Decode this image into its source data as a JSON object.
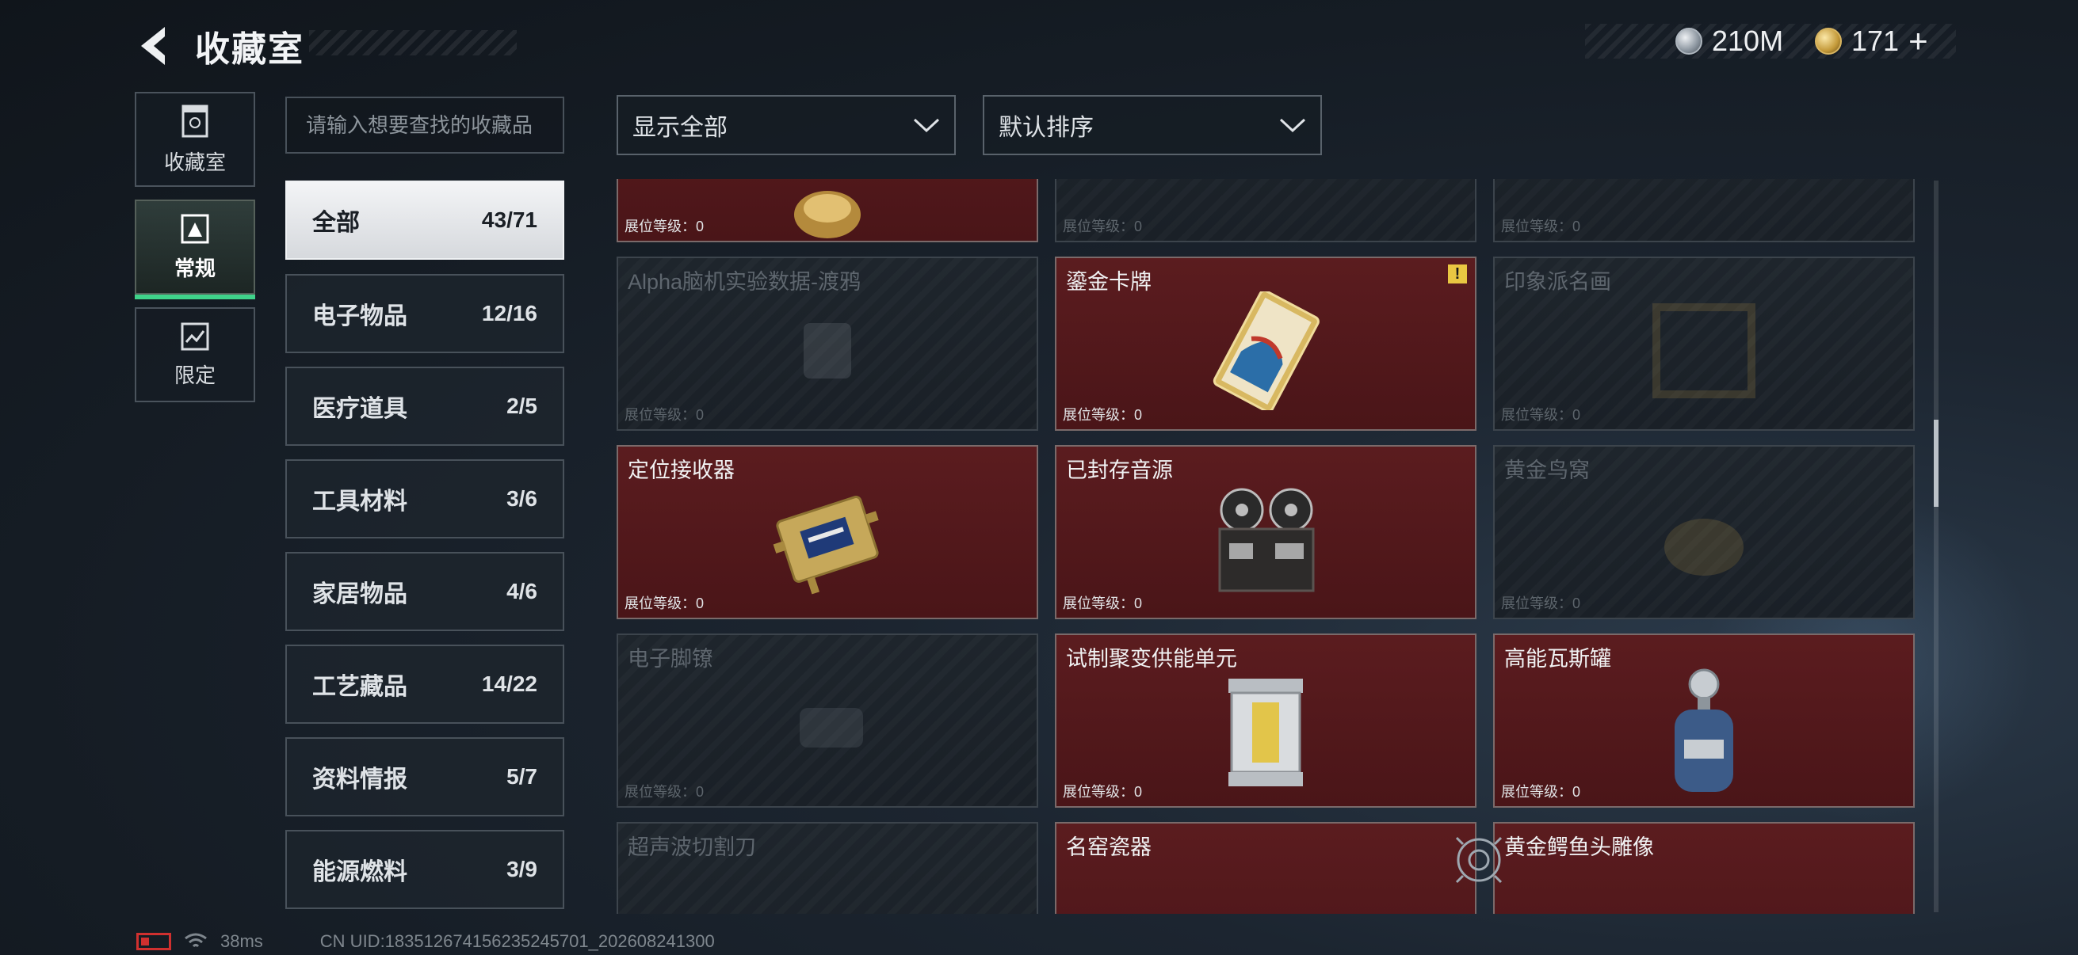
{
  "header": {
    "back_icon": "back-arrow-icon",
    "title": "收藏室",
    "currencies": [
      {
        "icon": "silver-coin-icon",
        "value": "210M"
      },
      {
        "icon": "gold-coin-icon",
        "value": "171"
      }
    ],
    "add_label": "+"
  },
  "nav": [
    {
      "label": "收藏室",
      "icon": "display-case-icon",
      "active": false
    },
    {
      "label": "常规",
      "icon": "gallery-icon",
      "active": true
    },
    {
      "label": "限定",
      "icon": "limited-icon",
      "active": false
    }
  ],
  "search": {
    "placeholder": "请输入想要查找的收藏品",
    "value": ""
  },
  "filters": {
    "display": "显示全部",
    "sort": "默认排序"
  },
  "categories": [
    {
      "name": "全部",
      "count": "43/71",
      "active": true
    },
    {
      "name": "电子物品",
      "count": "12/16",
      "active": false
    },
    {
      "name": "医疗道具",
      "count": "2/5",
      "active": false
    },
    {
      "name": "工具材料",
      "count": "3/6",
      "active": false
    },
    {
      "name": "家居物品",
      "count": "4/6",
      "active": false
    },
    {
      "name": "工艺藏品",
      "count": "14/22",
      "active": false
    },
    {
      "name": "资料情报",
      "count": "5/7",
      "active": false
    },
    {
      "name": "能源燃料",
      "count": "3/9",
      "active": false
    }
  ],
  "level_label": "展位等级：0",
  "items": [
    {
      "name": "",
      "owned": true
    },
    {
      "name": "",
      "owned": false
    },
    {
      "name": "",
      "owned": false
    },
    {
      "name": "Alpha脑机实验数据-渡鸦",
      "owned": false
    },
    {
      "name": "鎏金卡牌",
      "owned": true,
      "warning": "!"
    },
    {
      "name": "印象派名画",
      "owned": false
    },
    {
      "name": "定位接收器",
      "owned": true
    },
    {
      "name": "已封存音源",
      "owned": true
    },
    {
      "name": "黄金鸟窝",
      "owned": false
    },
    {
      "name": "电子脚镣",
      "owned": false
    },
    {
      "name": "试制聚变供能单元",
      "owned": true
    },
    {
      "name": "高能瓦斯罐",
      "owned": true
    },
    {
      "name": "超声波切割刀",
      "owned": false
    },
    {
      "name": "名窑瓷器",
      "owned": true
    },
    {
      "name": "黄金鳄鱼头雕像",
      "owned": true
    }
  ],
  "footer": {
    "ping": "38ms",
    "uid": "CN UID:183512674156235245701_202608241300"
  }
}
